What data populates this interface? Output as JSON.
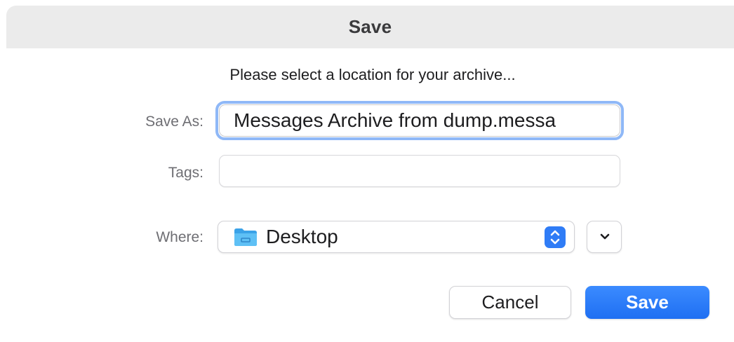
{
  "dialog": {
    "title": "Save",
    "prompt": "Please select a location for your archive..."
  },
  "form": {
    "save_as_label": "Save As:",
    "save_as_value": "Messages Archive from dump.messa",
    "tags_label": "Tags:",
    "tags_value": "",
    "where_label": "Where:",
    "where_value": "Desktop",
    "where_icon": "folder-icon"
  },
  "buttons": {
    "cancel_label": "Cancel",
    "save_label": "Save"
  },
  "colors": {
    "accent": "#2f7cf6",
    "focus_ring": "#8fb8f7",
    "titlebar": "#ebebeb"
  }
}
